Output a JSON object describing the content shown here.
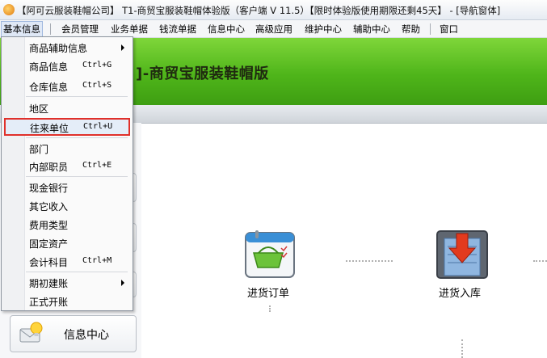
{
  "window": {
    "title": "【阿可云服装鞋帽公司】 T1-商贸宝服装鞋帽体验版（客户端 V 11.5）【限时体验版使用期限还剩45天】 - [导航窗体]"
  },
  "menubar": {
    "items": [
      "基本信息",
      "会员管理",
      "业务单据",
      "钱流单据",
      "信息中心",
      "高级应用",
      "维护中心",
      "辅助中心",
      "帮助",
      "窗口"
    ]
  },
  "banner": {
    "title": "T1-商贸宝服装鞋帽版",
    "visible_title": "]-商贸宝服装鞋帽版"
  },
  "dropdown": {
    "groups": [
      [
        {
          "label": "商品辅助信息",
          "shortcut": "",
          "submenu": true
        },
        {
          "label": "商品信息",
          "shortcut": "Ctrl+G",
          "submenu": false
        },
        {
          "label": "仓库信息",
          "shortcut": "Ctrl+S",
          "submenu": false
        }
      ],
      [
        {
          "label": "地区",
          "shortcut": "",
          "submenu": false
        },
        {
          "label": "往来单位",
          "shortcut": "Ctrl+U",
          "submenu": false,
          "highlighted": true
        }
      ],
      [
        {
          "label": "部门",
          "shortcut": "",
          "submenu": false
        },
        {
          "label": "内部职员",
          "shortcut": "Ctrl+E",
          "submenu": false
        }
      ],
      [
        {
          "label": "现金银行",
          "shortcut": "",
          "submenu": false
        },
        {
          "label": "其它收入",
          "shortcut": "",
          "submenu": false
        },
        {
          "label": "费用类型",
          "shortcut": "",
          "submenu": false
        },
        {
          "label": "固定资产",
          "shortcut": "",
          "submenu": false
        },
        {
          "label": "会计科目",
          "shortcut": "Ctrl+M",
          "submenu": false
        }
      ],
      [
        {
          "label": "期初建账",
          "shortcut": "",
          "submenu": true
        },
        {
          "label": "正式开账",
          "shortcut": "",
          "submenu": false
        }
      ]
    ]
  },
  "side_panel": {
    "info_center_label": "信息中心"
  },
  "flow": {
    "purchase_order_label": "进货订单",
    "purchase_in_label": "进货入库"
  },
  "colors": {
    "banner_green": "#4fb51a",
    "highlight_border": "#e0302a",
    "flow_arrow_red": "#e23a1e"
  }
}
